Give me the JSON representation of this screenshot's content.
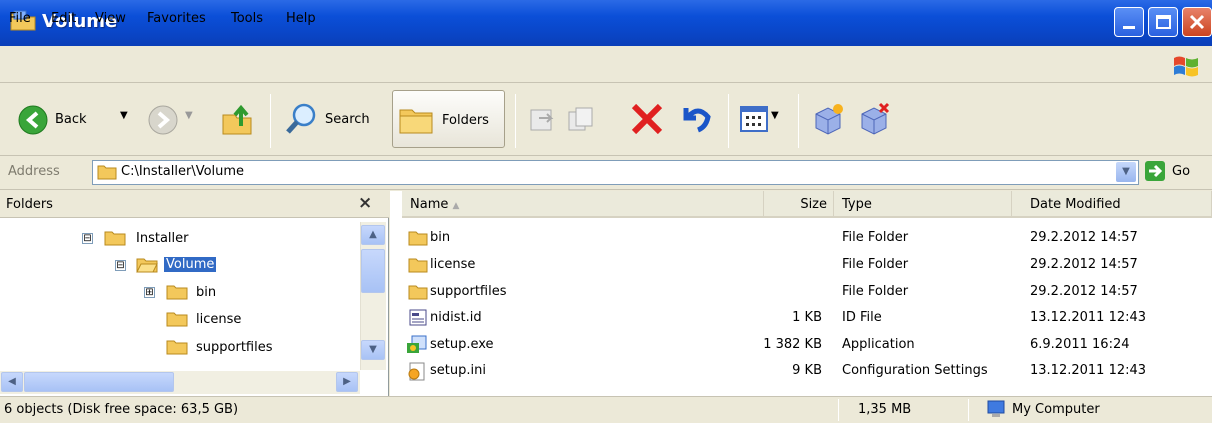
{
  "window": {
    "title": "Volume"
  },
  "menu": [
    "File",
    "Edit",
    "View",
    "Favorites",
    "Tools",
    "Help"
  ],
  "toolbar": {
    "back_label": "Back",
    "search_label": "Search",
    "folders_label": "Folders"
  },
  "address": {
    "label": "Address",
    "value": "C:\\Installer\\Volume",
    "go_label": "Go"
  },
  "left_pane": {
    "title": "Folders",
    "tree": [
      {
        "label": "Installer",
        "expander": "⊟"
      },
      {
        "label": "Volume",
        "expander": "⊟"
      },
      {
        "label": "bin",
        "expander": "⊞"
      },
      {
        "label": "license",
        "expander": ""
      },
      {
        "label": "supportfiles",
        "expander": ""
      }
    ]
  },
  "columns": {
    "name": "Name",
    "size": "Size",
    "type": "Type",
    "date": "Date Modified"
  },
  "files": [
    {
      "name": "bin",
      "size": "",
      "type": "File Folder",
      "date": "29.2.2012 14:57",
      "icon": "folder-icon"
    },
    {
      "name": "license",
      "size": "",
      "type": "File Folder",
      "date": "29.2.2012 14:57",
      "icon": "folder-icon"
    },
    {
      "name": "supportfiles",
      "size": "",
      "type": "File Folder",
      "date": "29.2.2012 14:57",
      "icon": "folder-icon"
    },
    {
      "name": "nidist.id",
      "size": "1 KB",
      "type": "ID File",
      "date": "13.12.2011 12:43",
      "icon": "id-file-icon"
    },
    {
      "name": "setup.exe",
      "size": "1 382 KB",
      "type": "Application",
      "date": "6.9.2011 16:24",
      "icon": "setup-exe-icon"
    },
    {
      "name": "setup.ini",
      "size": "9 KB",
      "type": "Configuration Settings",
      "date": "13.12.2011 12:43",
      "icon": "ini-file-icon"
    }
  ],
  "status": {
    "objects": "6 objects (Disk free space: 63,5 GB)",
    "size": "1,35 MB",
    "location": "My Computer"
  }
}
